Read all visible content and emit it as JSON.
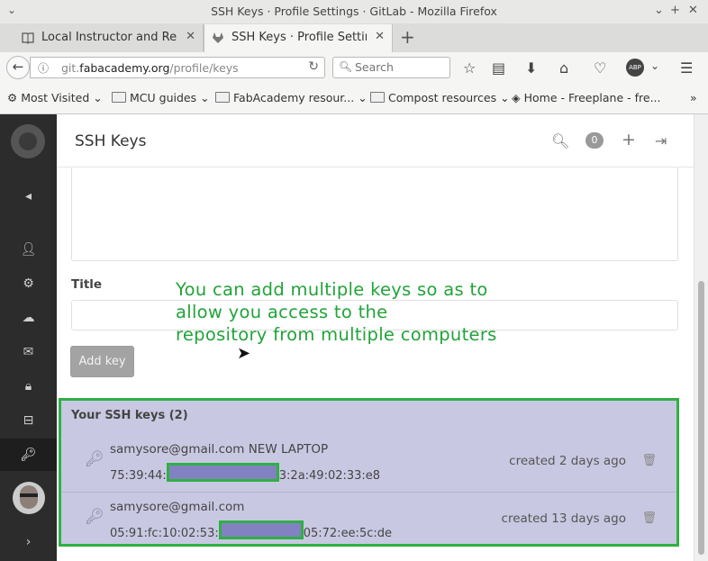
{
  "window": {
    "title": "SSH Keys · Profile Settings · GitLab - Mozilla Firefox"
  },
  "tabs": [
    {
      "label": "Local Instructor and Re...",
      "icon": "book-icon"
    },
    {
      "label": "SSH Keys · Profile Settin...",
      "icon": "gitlab-fox-icon"
    }
  ],
  "nav": {
    "url_prefix": "git.",
    "url_domain": "fabacademy.org",
    "url_path": "/profile/keys",
    "search_placeholder": "Search"
  },
  "bookmarks": [
    {
      "label": "Most Visited",
      "icon": "gear-icon"
    },
    {
      "label": "MCU guides",
      "icon": "folder-icon"
    },
    {
      "label": "FabAcademy resour...",
      "icon": "folder-icon"
    },
    {
      "label": "Compost resources",
      "icon": "folder-icon"
    },
    {
      "label": "Home - Freeplane - fre...",
      "icon": "freeplane-icon"
    }
  ],
  "page": {
    "title": "SSH Keys",
    "notification_count": "0",
    "title_label": "Title",
    "add_key_label": "Add key",
    "annotation": [
      "You can add multiple keys so as to",
      "allow you access to the",
      "repository from multiple computers"
    ]
  },
  "keys": {
    "heading": "Your SSH keys (2)",
    "items": [
      {
        "name": "samysore@gmail.com NEW LAPTOP",
        "fp_start": "75:39:44:",
        "fp_end": "3:2a:49:02:33:e8",
        "created": "created 2 days ago"
      },
      {
        "name": "samysore@gmail.com",
        "fp_start": "05:91:fc:10:02:53:",
        "fp_end": "05:72:ee:5c:de",
        "created": "created 13 days ago"
      }
    ]
  },
  "colors": {
    "annotation": "#22a33a",
    "highlight_border": "#2fb042",
    "highlight_bg": "#c8c8e2",
    "redaction": "#8282c3"
  }
}
